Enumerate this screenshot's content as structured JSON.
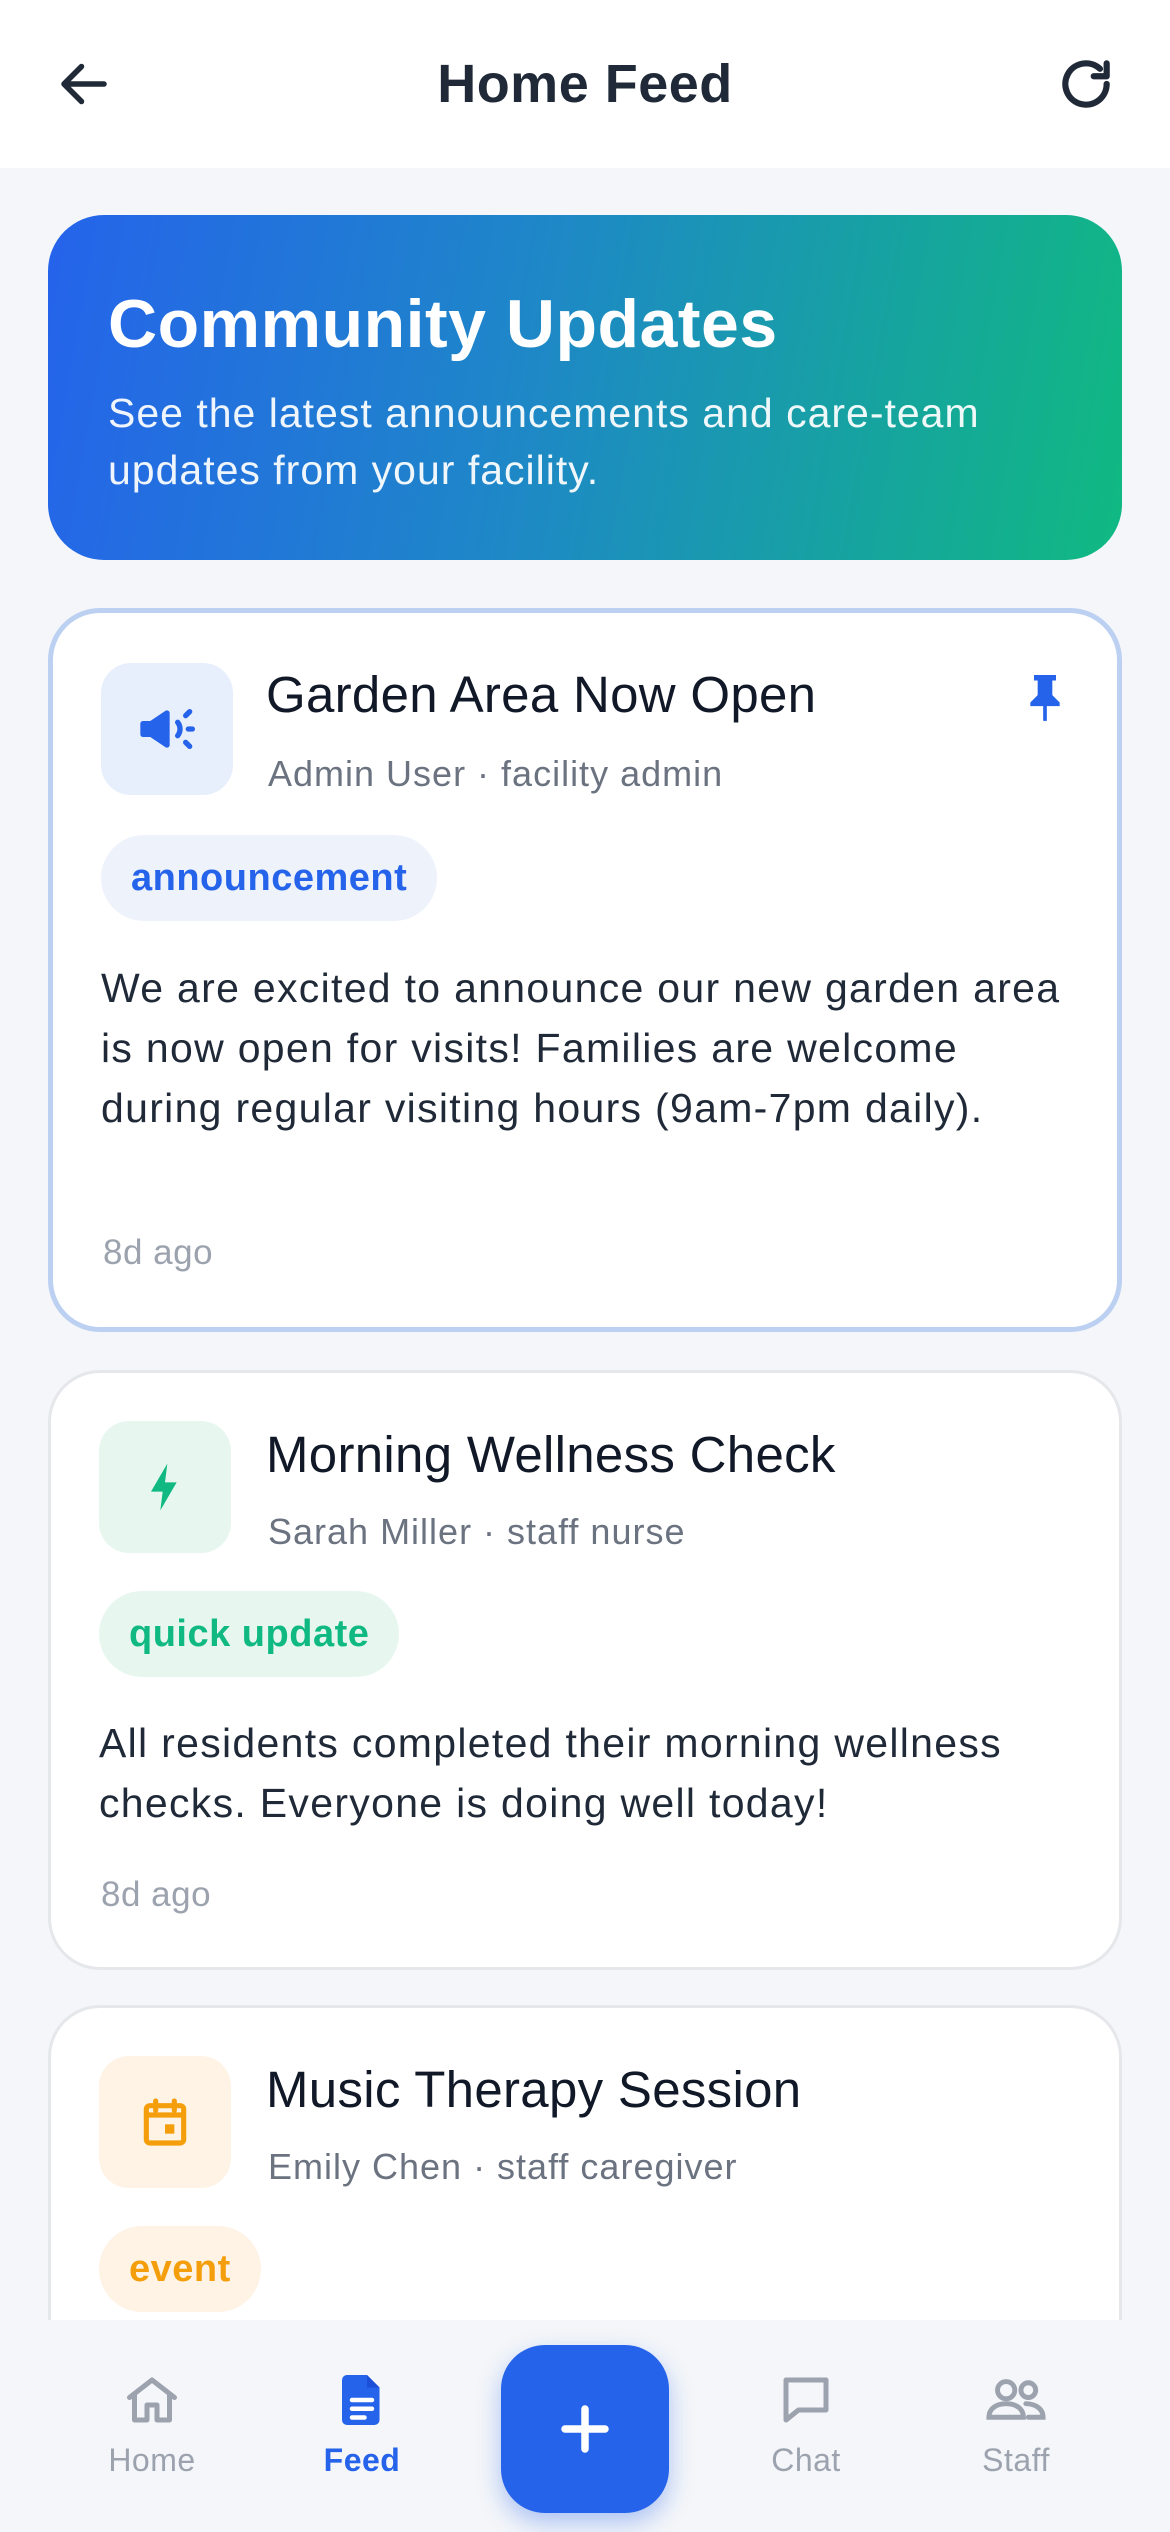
{
  "header": {
    "title": "Home Feed",
    "back_icon": "arrow-left-icon",
    "refresh_icon": "refresh-icon"
  },
  "hero": {
    "title": "Community Updates",
    "subtitle": "See the latest announcements and care-team updates from your facility."
  },
  "posts": [
    {
      "title": "Garden Area Now Open",
      "author": "Admin User · facility admin",
      "tag": "announcement",
      "body": "We are excited to announce our new garden area is now open for visits! Families are welcome during regular visiting hours (9am-7pm daily).",
      "time": "8d ago",
      "pinned": true,
      "icon": "megaphone-icon",
      "accent": "#2563eb",
      "accent_bg": "#e8effc"
    },
    {
      "title": "Morning Wellness Check",
      "author": "Sarah Miller · staff nurse",
      "tag": "quick update",
      "body": "All residents completed their morning wellness checks. Everyone is doing well today!",
      "time": "8d ago",
      "pinned": false,
      "icon": "lightning-icon",
      "accent": "#10b981",
      "accent_bg": "#e7f7f0"
    },
    {
      "title": "Music Therapy Session",
      "author": "Emily Chen · staff caregiver",
      "tag": "event",
      "pinned": false,
      "icon": "calendar-icon",
      "accent": "#f59e0b",
      "accent_bg": "#fef3e4"
    }
  ],
  "nav": {
    "items": [
      {
        "label": "Home",
        "icon": "home-icon",
        "active": false
      },
      {
        "label": "Feed",
        "icon": "document-icon",
        "active": true
      },
      {
        "label": "Chat",
        "icon": "chat-bubble-icon",
        "active": false
      },
      {
        "label": "Staff",
        "icon": "users-icon",
        "active": false
      }
    ],
    "fab_icon": "plus-icon"
  },
  "colors": {
    "primary": "#2563eb",
    "success": "#10b981",
    "warning": "#f59e0b"
  }
}
